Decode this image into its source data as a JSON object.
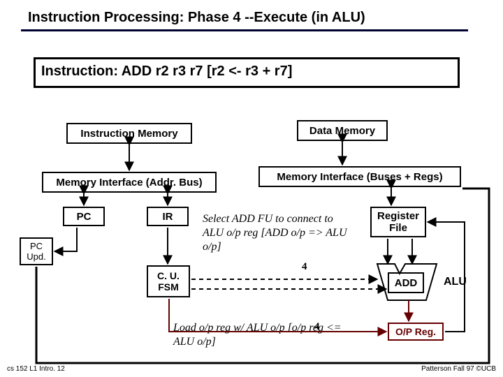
{
  "title": "Instruction Processing: Phase 4 --Execute (in ALU)",
  "instruction": "Instruction: ADD r2 r3 r7  [r2 <- r3 + r7]",
  "blocks": {
    "instr_mem": "Instruction Memory",
    "data_mem": "Data Memory",
    "mem_if_left": "Memory Interface (Addr. Bus)",
    "mem_if_right": "Memory Interface (Buses + Regs)",
    "pc": "PC",
    "ir": "IR",
    "pc_upd": "PC Upd.",
    "cu_fsm": "C. U. FSM",
    "reg_file": "Register File",
    "add": "ADD",
    "alu": "ALU",
    "op_reg": "O/P Reg."
  },
  "annotations": {
    "select_fu": "Select ADD FU to connect to ALU o/p reg [ADD o/p => ALU o/p]",
    "load_reg": "Load o/p reg w/ ALU o/p [o/p reg <= ALU o/p]",
    "step_a": "4",
    "step_b": "4"
  },
  "footer": {
    "left": "cs 152  L1 Intro. 12",
    "right": "Patterson Fall 97 ©UCB"
  }
}
